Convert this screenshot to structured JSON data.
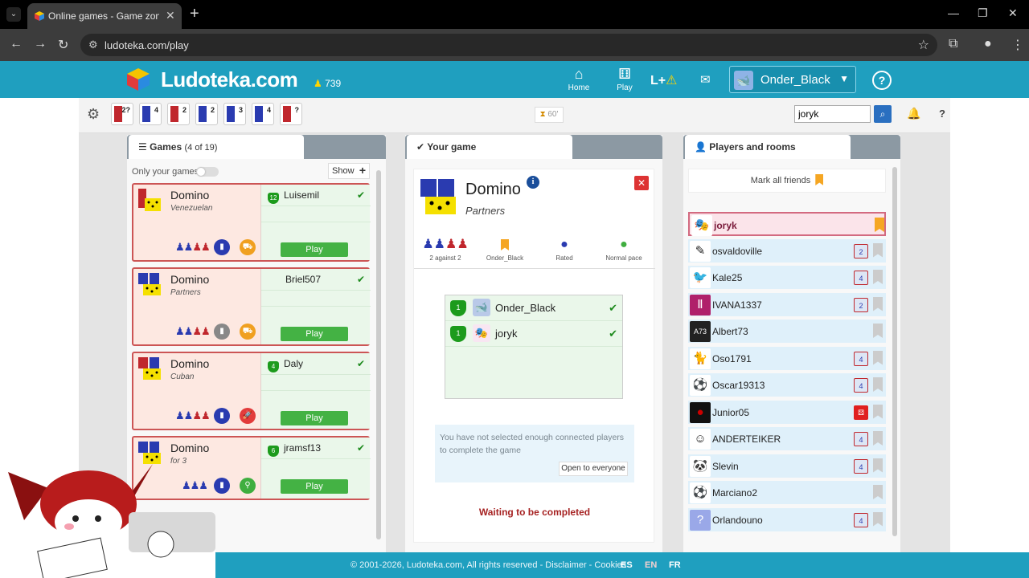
{
  "browser": {
    "tab_title": "Online games - Game zone - Lu",
    "url": "ludoteka.com/play",
    "tab_close": "✕",
    "new_tab": "+",
    "tab_dropdown": "⌄"
  },
  "header": {
    "logo_text": "Ludoteka.com",
    "user_count": "739",
    "nav": [
      {
        "label": "Home",
        "icon": "home-icon"
      },
      {
        "label": "Play",
        "icon": "dice-icon"
      }
    ],
    "lplus_label": "L+",
    "user_name": "Onder_Black"
  },
  "toolbar": {
    "filters": [
      {
        "icon": "2P-icon",
        "num": "2?"
      },
      {
        "icon": "4P-icon",
        "num": "4"
      },
      {
        "icon": "2P-icon",
        "num": "2"
      },
      {
        "icon": "2P-icon",
        "num": "2"
      },
      {
        "icon": "3P-icon",
        "num": "3"
      },
      {
        "icon": "4P-icon",
        "num": "4"
      },
      {
        "icon": "1P-icon",
        "num": "?"
      }
    ],
    "timer": "60'",
    "search_value": "joryk"
  },
  "games_panel": {
    "title": "Games",
    "count": "(4 of 19)",
    "only_label": "Only your games",
    "show_label": "Show",
    "cards": [
      {
        "title": "Domino",
        "sub": "Venezuelan",
        "player": "Luisemil",
        "level": "12",
        "play": "Play",
        "badge1": "rated",
        "badge2": "slow",
        "icon_color": "#c0272d"
      },
      {
        "title": "Domino",
        "sub": "Partners",
        "player": "Briel507",
        "level": "",
        "play": "Play",
        "badge1": "friendly",
        "badge2": "slow",
        "icon_color": "#2a3bb0"
      },
      {
        "title": "Domino",
        "sub": "Cuban",
        "player": "Daly",
        "level": "4",
        "play": "Play",
        "badge1": "rated",
        "badge2": "fast",
        "icon_color": "#c0272d"
      },
      {
        "title": "Domino",
        "sub": "for 3",
        "player": "jramsf13",
        "level": "6",
        "play": "Play",
        "badge1": "rated",
        "badge2": "normal",
        "icon_color": "#2a3bb0"
      }
    ]
  },
  "your_game": {
    "tab_label": "Your game",
    "title": "Domino",
    "sub": "Partners",
    "props": [
      {
        "label": "2 against 2",
        "icon": "teams-icon"
      },
      {
        "label": "Onder_Black",
        "icon": "bookmark-icon"
      },
      {
        "label": "Rated",
        "icon": "rated-icon"
      },
      {
        "label": "Normal pace",
        "icon": "bike-icon"
      }
    ],
    "players": [
      {
        "name": "Onder_Black",
        "level": "1"
      },
      {
        "name": "joryk",
        "level": "1"
      }
    ],
    "notice": "You have not selected enough connected players to complete the game",
    "open_label": "Open to everyone",
    "waiting": "Waiting to be completed"
  },
  "players_panel": {
    "tab_label": "Players and rooms",
    "mark_label": "Mark all friends",
    "players": [
      {
        "name": "joryk",
        "avatar": "mask-icon",
        "game": "",
        "marked": true,
        "selected": true
      },
      {
        "name": "osvaldoville",
        "avatar": "pen-icon",
        "game": "2",
        "marked": false,
        "selected": false
      },
      {
        "name": "Kale25",
        "avatar": "bird-icon",
        "game": "4",
        "marked": false,
        "selected": false
      },
      {
        "name": "IVANA1337",
        "avatar": "pillar-icon",
        "game": "2",
        "marked": false,
        "selected": false
      },
      {
        "name": "Albert73",
        "avatar": "A73-icon",
        "game": "",
        "marked": false,
        "selected": false
      },
      {
        "name": "Oso1791",
        "avatar": "cat-icon",
        "game": "4",
        "marked": false,
        "selected": false
      },
      {
        "name": "Oscar19313",
        "avatar": "soccer-icon",
        "game": "4",
        "marked": false,
        "selected": false
      },
      {
        "name": "Junior05",
        "avatar": "dark-icon",
        "game": "dice",
        "marked": false,
        "selected": false
      },
      {
        "name": "ANDERTEIKER",
        "avatar": "man-icon",
        "game": "4",
        "marked": false,
        "selected": false
      },
      {
        "name": "Slevin",
        "avatar": "panda-icon",
        "game": "4",
        "marked": false,
        "selected": false
      },
      {
        "name": "Marciano2",
        "avatar": "soccer-icon",
        "game": "",
        "marked": false,
        "selected": false
      },
      {
        "name": "Orlandouno",
        "avatar": "blank-icon",
        "game": "4",
        "marked": false,
        "selected": false
      }
    ]
  },
  "footer": {
    "text": "© 2001-2026, Ludoteka.com, All rights reserved - Disclaimer - Cookies",
    "langs": [
      "ES",
      "EN",
      "FR"
    ]
  }
}
